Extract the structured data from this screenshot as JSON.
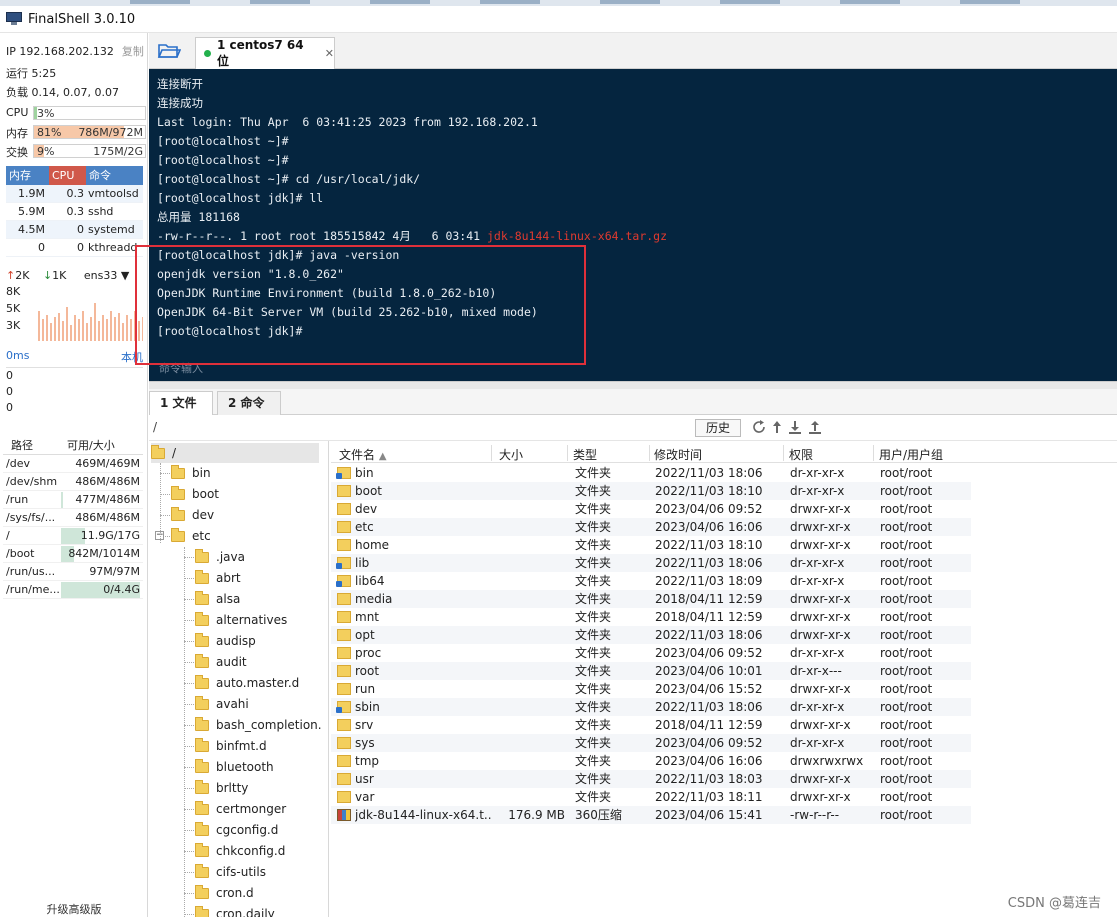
{
  "window": {
    "title": "FinalShell 3.0.10"
  },
  "monitor": {
    "ip_label": "IP 192.168.202.132",
    "copy_label": "复制",
    "uptime": "运行 5:25",
    "load": "负载 0.14, 0.07, 0.07",
    "cpu": {
      "label": "CPU",
      "pct": "3%",
      "fraction": 0.03
    },
    "mem": {
      "label": "内存",
      "pct": "81%",
      "amount": "786M/972M",
      "fraction": 0.81
    },
    "swap": {
      "label": "交换",
      "pct": "9%",
      "amount": "175M/2G",
      "fraction": 0.09
    },
    "process_headers": [
      "内存",
      "CPU",
      "命令"
    ],
    "processes": [
      {
        "mem": "1.9M",
        "cpu": "0.3",
        "cmd": "vmtoolsd"
      },
      {
        "mem": "5.9M",
        "cpu": "0.3",
        "cmd": "sshd"
      },
      {
        "mem": "4.5M",
        "cpu": "0",
        "cmd": "systemd"
      },
      {
        "mem": "0",
        "cpu": "0",
        "cmd": "kthreadd"
      }
    ],
    "net": {
      "up": "2K",
      "down": "1K",
      "iface": "ens33",
      "scale": [
        "8K",
        "5K",
        "3K"
      ]
    },
    "ping": {
      "ms": "0ms",
      "local": "本机",
      "values": [
        "0",
        "0",
        "0"
      ]
    },
    "disk_headers": [
      "路径",
      "可用/大小"
    ],
    "disks": [
      {
        "path": "/dev",
        "size": "469M/469M",
        "used": 0.0
      },
      {
        "path": "/dev/shm",
        "size": "486M/486M",
        "used": 0.0
      },
      {
        "path": "/run",
        "size": "477M/486M",
        "used": 0.02
      },
      {
        "path": "/sys/fs/...",
        "size": "486M/486M",
        "used": 0.0
      },
      {
        "path": "/",
        "size": "11.9G/17G",
        "used": 0.3
      },
      {
        "path": "/boot",
        "size": "842M/1014M",
        "used": 0.17
      },
      {
        "path": "/run/us...",
        "size": "97M/97M",
        "used": 0.0
      },
      {
        "path": "/run/me...",
        "size": "0/4.4G",
        "used": 1.0
      }
    ],
    "upgrade": "升级高级版"
  },
  "session": {
    "tab_label": "1 centos7 64位",
    "close": "✕"
  },
  "terminal": {
    "lines": [
      "连接断开",
      "连接成功",
      "Last login: Thu Apr  6 03:41:25 2023 from 192.168.202.1",
      "[root@localhost ~]#",
      "[root@localhost ~]#",
      "[root@localhost ~]# cd /usr/local/jdk/",
      "[root@localhost jdk]# ll",
      "总用量 181168"
    ],
    "ls_prefix": "-rw-r--r--. 1 root root 185515842 4月   6 03:41 ",
    "ls_file": "jdk-8u144-linux-x64.tar.gz",
    "lines2": [
      "[root@localhost jdk]# java -version",
      "openjdk version \"1.8.0_262\"",
      "OpenJDK Runtime Environment (build 1.8.0_262-b10)",
      "OpenJDK 64-Bit Server VM (build 25.262-b10, mixed mode)",
      "[root@localhost jdk]#"
    ],
    "input_placeholder": "命令输入",
    "highlight_color": "#e0303a"
  },
  "lower_tabs": [
    "1 文件",
    "2 命令"
  ],
  "pathbar": {
    "path": "/",
    "history": "历史"
  },
  "tree": {
    "root": "/",
    "items": [
      "bin",
      "boot",
      "dev",
      "etc",
      ".java",
      "abrt",
      "alsa",
      "alternatives",
      "audisp",
      "audit",
      "auto.master.d",
      "avahi",
      "bash_completion.",
      "binfmt.d",
      "bluetooth",
      "brltty",
      "certmonger",
      "cgconfig.d",
      "chkconfig.d",
      "cifs-utils",
      "cron.d",
      "cron.daily"
    ]
  },
  "files": {
    "headers": [
      "文件名",
      "大小",
      "类型",
      "修改时间",
      "权限",
      "用户/用户组"
    ],
    "rows": [
      {
        "name": "bin",
        "size": "",
        "type": "文件夹",
        "mtime": "2022/11/03 18:06",
        "perm": "dr-xr-xr-x",
        "owner": "root/root",
        "icon": "link"
      },
      {
        "name": "boot",
        "size": "",
        "type": "文件夹",
        "mtime": "2022/11/03 18:10",
        "perm": "dr-xr-xr-x",
        "owner": "root/root",
        "icon": "folder"
      },
      {
        "name": "dev",
        "size": "",
        "type": "文件夹",
        "mtime": "2023/04/06 09:52",
        "perm": "drwxr-xr-x",
        "owner": "root/root",
        "icon": "folder"
      },
      {
        "name": "etc",
        "size": "",
        "type": "文件夹",
        "mtime": "2023/04/06 16:06",
        "perm": "drwxr-xr-x",
        "owner": "root/root",
        "icon": "folder"
      },
      {
        "name": "home",
        "size": "",
        "type": "文件夹",
        "mtime": "2022/11/03 18:10",
        "perm": "drwxr-xr-x",
        "owner": "root/root",
        "icon": "folder"
      },
      {
        "name": "lib",
        "size": "",
        "type": "文件夹",
        "mtime": "2022/11/03 18:06",
        "perm": "dr-xr-xr-x",
        "owner": "root/root",
        "icon": "link"
      },
      {
        "name": "lib64",
        "size": "",
        "type": "文件夹",
        "mtime": "2022/11/03 18:09",
        "perm": "dr-xr-xr-x",
        "owner": "root/root",
        "icon": "link"
      },
      {
        "name": "media",
        "size": "",
        "type": "文件夹",
        "mtime": "2018/04/11 12:59",
        "perm": "drwxr-xr-x",
        "owner": "root/root",
        "icon": "folder"
      },
      {
        "name": "mnt",
        "size": "",
        "type": "文件夹",
        "mtime": "2018/04/11 12:59",
        "perm": "drwxr-xr-x",
        "owner": "root/root",
        "icon": "folder"
      },
      {
        "name": "opt",
        "size": "",
        "type": "文件夹",
        "mtime": "2022/11/03 18:06",
        "perm": "drwxr-xr-x",
        "owner": "root/root",
        "icon": "folder"
      },
      {
        "name": "proc",
        "size": "",
        "type": "文件夹",
        "mtime": "2023/04/06 09:52",
        "perm": "dr-xr-xr-x",
        "owner": "root/root",
        "icon": "folder"
      },
      {
        "name": "root",
        "size": "",
        "type": "文件夹",
        "mtime": "2023/04/06 10:01",
        "perm": "dr-xr-x---",
        "owner": "root/root",
        "icon": "folder"
      },
      {
        "name": "run",
        "size": "",
        "type": "文件夹",
        "mtime": "2023/04/06 15:52",
        "perm": "drwxr-xr-x",
        "owner": "root/root",
        "icon": "folder"
      },
      {
        "name": "sbin",
        "size": "",
        "type": "文件夹",
        "mtime": "2022/11/03 18:06",
        "perm": "dr-xr-xr-x",
        "owner": "root/root",
        "icon": "link"
      },
      {
        "name": "srv",
        "size": "",
        "type": "文件夹",
        "mtime": "2018/04/11 12:59",
        "perm": "drwxr-xr-x",
        "owner": "root/root",
        "icon": "folder"
      },
      {
        "name": "sys",
        "size": "",
        "type": "文件夹",
        "mtime": "2023/04/06 09:52",
        "perm": "dr-xr-xr-x",
        "owner": "root/root",
        "icon": "folder"
      },
      {
        "name": "tmp",
        "size": "",
        "type": "文件夹",
        "mtime": "2023/04/06 16:06",
        "perm": "drwxrwxrwx",
        "owner": "root/root",
        "icon": "folder"
      },
      {
        "name": "usr",
        "size": "",
        "type": "文件夹",
        "mtime": "2022/11/03 18:03",
        "perm": "drwxr-xr-x",
        "owner": "root/root",
        "icon": "folder"
      },
      {
        "name": "var",
        "size": "",
        "type": "文件夹",
        "mtime": "2022/11/03 18:11",
        "perm": "drwxr-xr-x",
        "owner": "root/root",
        "icon": "folder"
      },
      {
        "name": "jdk-8u144-linux-x64.t...",
        "size": "176.9 MB",
        "type": "360压缩",
        "mtime": "2023/04/06 15:41",
        "perm": "-rw-r--r--",
        "owner": "root/root",
        "icon": "zip"
      }
    ]
  },
  "watermark": "CSDN @葛连吉",
  "colors": {
    "terminal_bg": "#05253f",
    "mem_bar": "#f7c8a8",
    "cpu_header": "#d0584a",
    "proc_header": "#4a82c4"
  }
}
